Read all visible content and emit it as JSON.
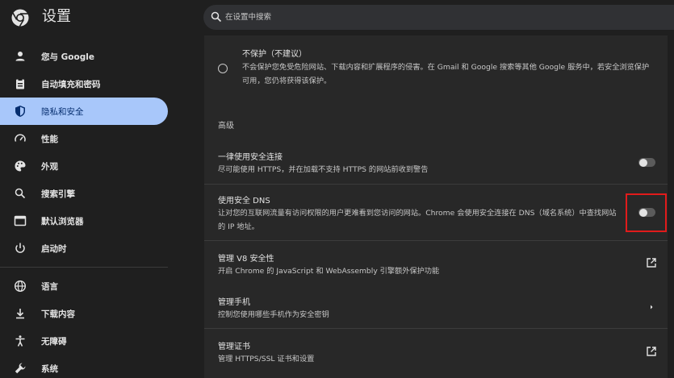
{
  "header": {
    "title": "设置",
    "search_placeholder": "在设置中搜索"
  },
  "sidebar": {
    "items": [
      {
        "label": "您与 Google",
        "icon": "person-icon"
      },
      {
        "label": "自动填充和密码",
        "icon": "clipboard-icon"
      },
      {
        "label": "隐私和安全",
        "icon": "shield-icon",
        "active": true
      },
      {
        "label": "性能",
        "icon": "speedometer-icon"
      },
      {
        "label": "外观",
        "icon": "palette-icon"
      },
      {
        "label": "搜索引擎",
        "icon": "search-icon"
      },
      {
        "label": "默认浏览器",
        "icon": "browser-icon"
      },
      {
        "label": "启动时",
        "icon": "power-icon"
      },
      {
        "label": "语言",
        "icon": "globe-icon"
      },
      {
        "label": "下载内容",
        "icon": "download-icon"
      },
      {
        "label": "无障碍",
        "icon": "accessibility-icon"
      },
      {
        "label": "系统",
        "icon": "wrench-icon"
      }
    ]
  },
  "main": {
    "no_protection": {
      "title": "不保护（不建议）",
      "description": "不会保护您免受危险网站、下载内容和扩展程序的侵害。在 Gmail 和 Google 搜索等其他 Google 服务中，若安全浏览保护可用，您仍将获得该保护。"
    },
    "section_advanced": "高级",
    "https": {
      "title": "一律使用安全连接",
      "description": "尽可能使用 HTTPS，并在加载不支持 HTTPS 的网站前收到警告",
      "enabled": false
    },
    "dns": {
      "title": "使用安全 DNS",
      "description": "让对您的互联网流量有访问权限的用户更难看到您访问的网站。Chrome 会使用安全连接在 DNS（域名系统）中查找网站的 IP 地址。",
      "enabled": false
    },
    "v8": {
      "title": "管理 V8 安全性",
      "description": "开启 Chrome 的 JavaScript 和 WebAssembly 引擎额外保护功能"
    },
    "phones": {
      "title": "管理手机",
      "description": "控制您使用哪些手机作为安全密钥"
    },
    "certs": {
      "title": "管理证书",
      "description": "管理 HTTPS/SSL 证书和设置"
    }
  },
  "colors": {
    "accent": "#a8c7fa",
    "active_text": "#062e6f",
    "highlight": "#e11b1b"
  }
}
